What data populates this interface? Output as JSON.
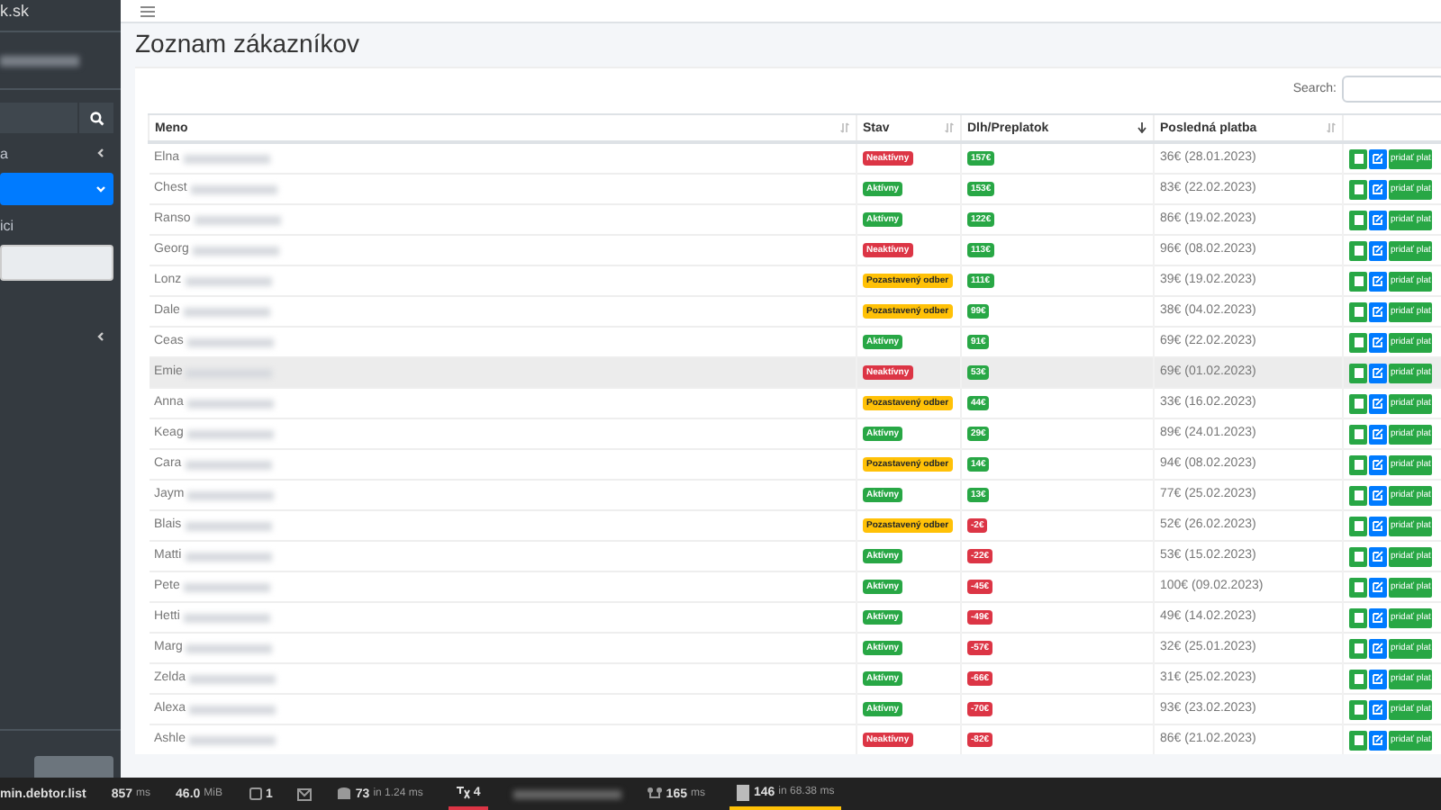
{
  "sidebar": {
    "brand": "k.sk",
    "menu": [
      {
        "label": "a",
        "kind": "collapsed",
        "selected": false
      },
      {
        "kind": "expanded",
        "selected": true
      },
      {
        "label": "ici",
        "kind": "plain",
        "selected": false
      },
      {
        "kind": "field",
        "selected": false
      },
      {
        "kind": "collapsed",
        "selected": false
      }
    ]
  },
  "page": {
    "title": "Zoznam zákazníkov"
  },
  "search_label": "Search:",
  "table": {
    "columns": [
      "Meno",
      "Stav",
      "Dlh/Preplatok",
      "Posledná platba"
    ],
    "rows": [
      {
        "name": "Elna",
        "status": {
          "text": "Neaktívny",
          "color": "#dc3545"
        },
        "balance": {
          "text": "157€",
          "color": "#28a745"
        },
        "last_payment": "36€ (28.01.2023)",
        "action": "pridať plat",
        "selected": false
      },
      {
        "name": "Chest",
        "status": {
          "text": "Aktívny",
          "color": "#28a745"
        },
        "balance": {
          "text": "153€",
          "color": "#28a745"
        },
        "last_payment": "83€ (22.02.2023)",
        "action": "pridať plat",
        "selected": false
      },
      {
        "name": "Ranso",
        "status": {
          "text": "Aktívny",
          "color": "#28a745"
        },
        "balance": {
          "text": "122€",
          "color": "#28a745"
        },
        "last_payment": "86€ (19.02.2023)",
        "action": "pridať plat",
        "selected": false
      },
      {
        "name": "Georg",
        "status": {
          "text": "Neaktívny",
          "color": "#dc3545"
        },
        "balance": {
          "text": "113€",
          "color": "#28a745"
        },
        "last_payment": "96€ (08.02.2023)",
        "action": "pridať plat",
        "selected": false
      },
      {
        "name": "Lonz",
        "status": {
          "text": "Pozastavený odber",
          "color": "#ffc107"
        },
        "balance": {
          "text": "111€",
          "color": "#28a745"
        },
        "last_payment": "39€ (19.02.2023)",
        "action": "pridať plat",
        "selected": false
      },
      {
        "name": "Dale",
        "status": {
          "text": "Pozastavený odber",
          "color": "#ffc107"
        },
        "balance": {
          "text": "99€",
          "color": "#28a745"
        },
        "last_payment": "38€ (04.02.2023)",
        "action": "pridať plat",
        "selected": false
      },
      {
        "name": "Ceas",
        "status": {
          "text": "Aktívny",
          "color": "#28a745"
        },
        "balance": {
          "text": "91€",
          "color": "#28a745"
        },
        "last_payment": "69€ (22.02.2023)",
        "action": "pridať plat",
        "selected": false
      },
      {
        "name": "Emie",
        "status": {
          "text": "Neaktívny",
          "color": "#dc3545"
        },
        "balance": {
          "text": "53€",
          "color": "#28a745"
        },
        "last_payment": "69€ (01.02.2023)",
        "action": "pridať plat",
        "selected": true
      },
      {
        "name": "Anna",
        "status": {
          "text": "Pozastavený odber",
          "color": "#ffc107"
        },
        "balance": {
          "text": "44€",
          "color": "#28a745"
        },
        "last_payment": "33€ (16.02.2023)",
        "action": "pridať plat",
        "selected": false
      },
      {
        "name": "Keag",
        "status": {
          "text": "Aktívny",
          "color": "#28a745"
        },
        "balance": {
          "text": "29€",
          "color": "#28a745"
        },
        "last_payment": "89€ (24.01.2023)",
        "action": "pridať plat",
        "selected": false
      },
      {
        "name": "Cara",
        "status": {
          "text": "Pozastavený odber",
          "color": "#ffc107"
        },
        "balance": {
          "text": "14€",
          "color": "#28a745"
        },
        "last_payment": "94€ (08.02.2023)",
        "action": "pridať plat",
        "selected": false
      },
      {
        "name": "Jaym",
        "status": {
          "text": "Aktívny",
          "color": "#28a745"
        },
        "balance": {
          "text": "13€",
          "color": "#28a745"
        },
        "last_payment": "77€ (25.02.2023)",
        "action": "pridať plat",
        "selected": false
      },
      {
        "name": "Blais",
        "status": {
          "text": "Pozastavený odber",
          "color": "#ffc107"
        },
        "balance": {
          "text": "-2€",
          "color": "#dc3545"
        },
        "last_payment": "52€ (26.02.2023)",
        "action": "pridať plat",
        "selected": false
      },
      {
        "name": "Matti",
        "status": {
          "text": "Aktívny",
          "color": "#28a745"
        },
        "balance": {
          "text": "-22€",
          "color": "#dc3545"
        },
        "last_payment": "53€ (15.02.2023)",
        "action": "pridať plat",
        "selected": false
      },
      {
        "name": "Pete",
        "status": {
          "text": "Aktívny",
          "color": "#28a745"
        },
        "balance": {
          "text": "-45€",
          "color": "#dc3545"
        },
        "last_payment": "100€ (09.02.2023)",
        "action": "pridať plat",
        "selected": false
      },
      {
        "name": "Hetti",
        "status": {
          "text": "Aktívny",
          "color": "#28a745"
        },
        "balance": {
          "text": "-49€",
          "color": "#dc3545"
        },
        "last_payment": "49€ (14.02.2023)",
        "action": "pridať plat",
        "selected": false
      },
      {
        "name": "Marg",
        "status": {
          "text": "Aktívny",
          "color": "#28a745"
        },
        "balance": {
          "text": "-57€",
          "color": "#dc3545"
        },
        "last_payment": "32€ (25.01.2023)",
        "action": "pridať plat",
        "selected": false
      },
      {
        "name": "Zelda",
        "status": {
          "text": "Aktívny",
          "color": "#28a745"
        },
        "balance": {
          "text": "-66€",
          "color": "#dc3545"
        },
        "last_payment": "31€ (25.02.2023)",
        "action": "pridať plat",
        "selected": false
      },
      {
        "name": "Alexa",
        "status": {
          "text": "Aktívny",
          "color": "#28a745"
        },
        "balance": {
          "text": "-70€",
          "color": "#dc3545"
        },
        "last_payment": "93€ (23.02.2023)",
        "action": "pridať plat",
        "selected": false
      },
      {
        "name": "Ashle",
        "status": {
          "text": "Neaktívny",
          "color": "#dc3545"
        },
        "balance": {
          "text": "-82€",
          "color": "#dc3545"
        },
        "last_payment": "86€ (21.02.2023)",
        "action": "pridať plat",
        "selected": false
      }
    ]
  },
  "debug_bar": {
    "route": "min.debtor.list",
    "time": "857",
    "time_unit": "ms",
    "memory": "46.0",
    "memory_unit": "MiB",
    "requests": "1",
    "queries": "73",
    "queries_time": "in 1.24 ms",
    "translations": "4",
    "ajax": "165",
    "ajax_unit": "ms",
    "views": "146",
    "views_time": "in 68.38 ms"
  }
}
